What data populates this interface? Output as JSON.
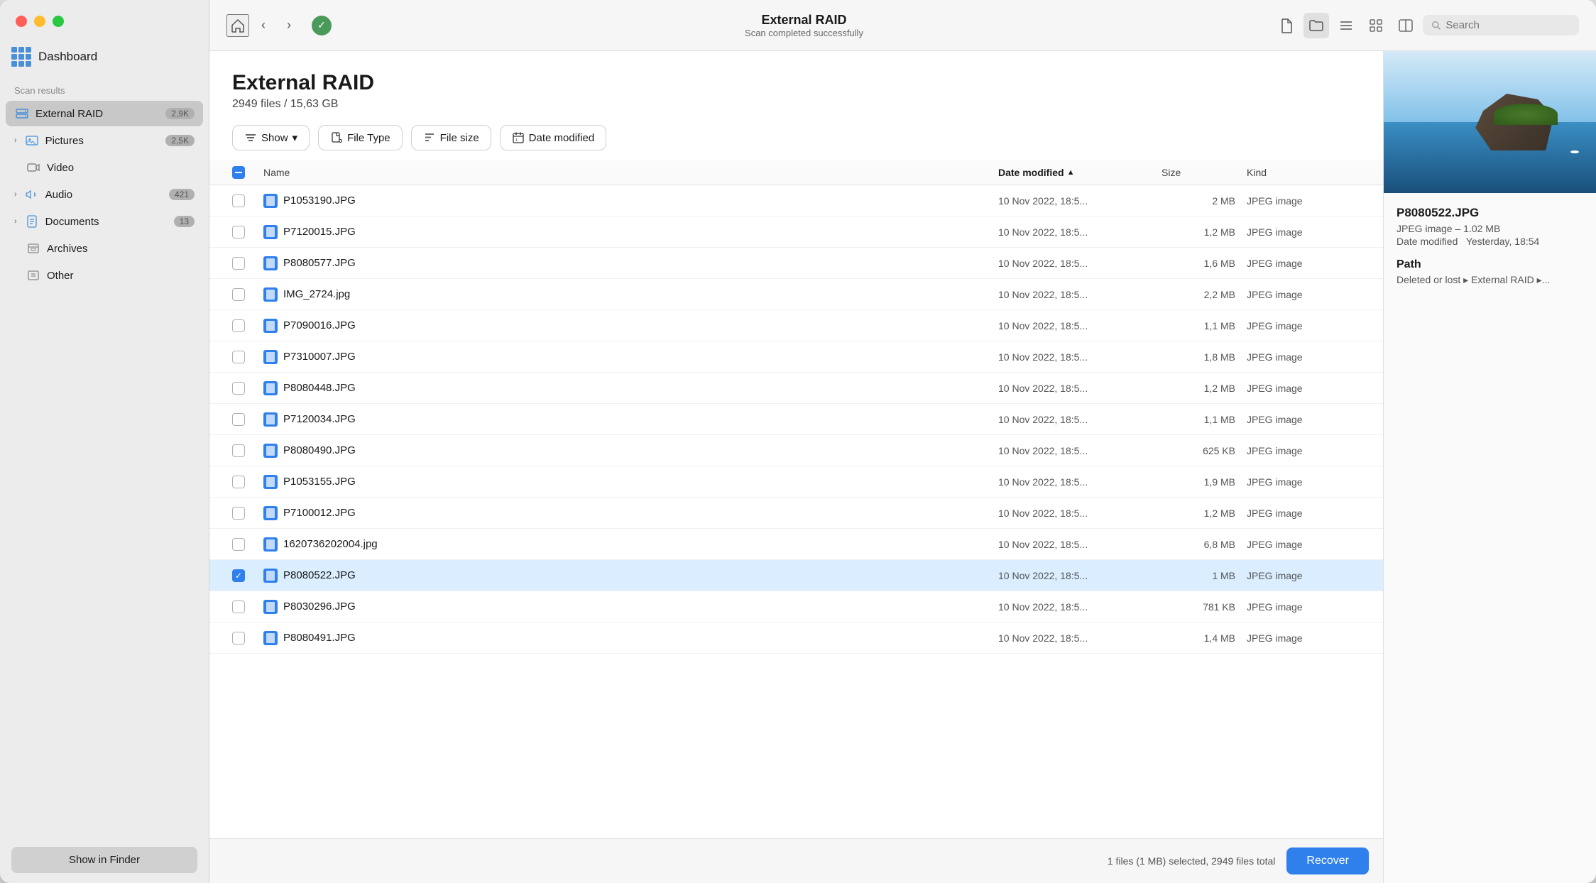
{
  "window": {
    "title": "External RAID",
    "subtitle": "Scan completed successfully"
  },
  "sidebar": {
    "section_label": "Scan results",
    "dashboard_label": "Dashboard",
    "items": [
      {
        "id": "external-raid",
        "label": "External RAID",
        "badge": "2,9K",
        "active": true,
        "has_icon": "raid"
      },
      {
        "id": "pictures",
        "label": "Pictures",
        "badge": "2,5K",
        "active": false,
        "expandable": true,
        "has_icon": "pictures"
      },
      {
        "id": "video",
        "label": "Video",
        "badge": "",
        "active": false,
        "has_icon": "video"
      },
      {
        "id": "audio",
        "label": "Audio",
        "badge": "421",
        "active": false,
        "expandable": true,
        "has_icon": "audio"
      },
      {
        "id": "documents",
        "label": "Documents",
        "badge": "13",
        "active": false,
        "expandable": true,
        "has_icon": "documents"
      },
      {
        "id": "archives",
        "label": "Archives",
        "badge": "",
        "active": false,
        "has_icon": "archives"
      },
      {
        "id": "other",
        "label": "Other",
        "badge": "",
        "active": false,
        "has_icon": "other"
      }
    ],
    "show_in_finder": "Show in Finder"
  },
  "toolbar": {
    "title": "External RAID",
    "subtitle": "Scan completed successfully",
    "search_placeholder": "Search"
  },
  "content": {
    "title": "External RAID",
    "subtitle": "2949 files / 15,63 GB"
  },
  "filters": {
    "show_label": "Show",
    "file_type_label": "File Type",
    "file_size_label": "File size",
    "date_modified_label": "Date modified"
  },
  "table": {
    "columns": [
      "",
      "Name",
      "Date modified",
      "Size",
      "Kind"
    ],
    "sort_column": "Date modified",
    "rows": [
      {
        "name": "P1053190.JPG",
        "date": "10 Nov 2022, 18:5...",
        "size": "2 MB",
        "kind": "JPEG image",
        "selected": false
      },
      {
        "name": "P7120015.JPG",
        "date": "10 Nov 2022, 18:5...",
        "size": "1,2 MB",
        "kind": "JPEG image",
        "selected": false
      },
      {
        "name": "P8080577.JPG",
        "date": "10 Nov 2022, 18:5...",
        "size": "1,6 MB",
        "kind": "JPEG image",
        "selected": false
      },
      {
        "name": "IMG_2724.jpg",
        "date": "10 Nov 2022, 18:5...",
        "size": "2,2 MB",
        "kind": "JPEG image",
        "selected": false
      },
      {
        "name": "P7090016.JPG",
        "date": "10 Nov 2022, 18:5...",
        "size": "1,1 MB",
        "kind": "JPEG image",
        "selected": false
      },
      {
        "name": "P7310007.JPG",
        "date": "10 Nov 2022, 18:5...",
        "size": "1,8 MB",
        "kind": "JPEG image",
        "selected": false
      },
      {
        "name": "P8080448.JPG",
        "date": "10 Nov 2022, 18:5...",
        "size": "1,2 MB",
        "kind": "JPEG image",
        "selected": false
      },
      {
        "name": "P7120034.JPG",
        "date": "10 Nov 2022, 18:5...",
        "size": "1,1 MB",
        "kind": "JPEG image",
        "selected": false
      },
      {
        "name": "P8080490.JPG",
        "date": "10 Nov 2022, 18:5...",
        "size": "625 KB",
        "kind": "JPEG image",
        "selected": false
      },
      {
        "name": "P1053155.JPG",
        "date": "10 Nov 2022, 18:5...",
        "size": "1,9 MB",
        "kind": "JPEG image",
        "selected": false
      },
      {
        "name": "P7100012.JPG",
        "date": "10 Nov 2022, 18:5...",
        "size": "1,2 MB",
        "kind": "JPEG image",
        "selected": false
      },
      {
        "name": "1620736202004.jpg",
        "date": "10 Nov 2022, 18:5...",
        "size": "6,8 MB",
        "kind": "JPEG image",
        "selected": false
      },
      {
        "name": "P8080522.JPG",
        "date": "10 Nov 2022, 18:5...",
        "size": "1 MB",
        "kind": "JPEG image",
        "selected": true
      },
      {
        "name": "P8030296.JPG",
        "date": "10 Nov 2022, 18:5...",
        "size": "781 KB",
        "kind": "JPEG image",
        "selected": false
      },
      {
        "name": "P8080491.JPG",
        "date": "10 Nov 2022, 18:5...",
        "size": "1,4 MB",
        "kind": "JPEG image",
        "selected": false
      }
    ]
  },
  "preview": {
    "filename": "P8080522.JPG",
    "filetype": "JPEG image – 1.02 MB",
    "date_label": "Date modified",
    "date_value": "Yesterday, 18:54",
    "path_label": "Path",
    "path_value": "Deleted or lost ▸ External RAID ▸..."
  },
  "status_bar": {
    "status_text": "1 files (1 MB) selected, 2949 files total",
    "recover_label": "Recover"
  }
}
